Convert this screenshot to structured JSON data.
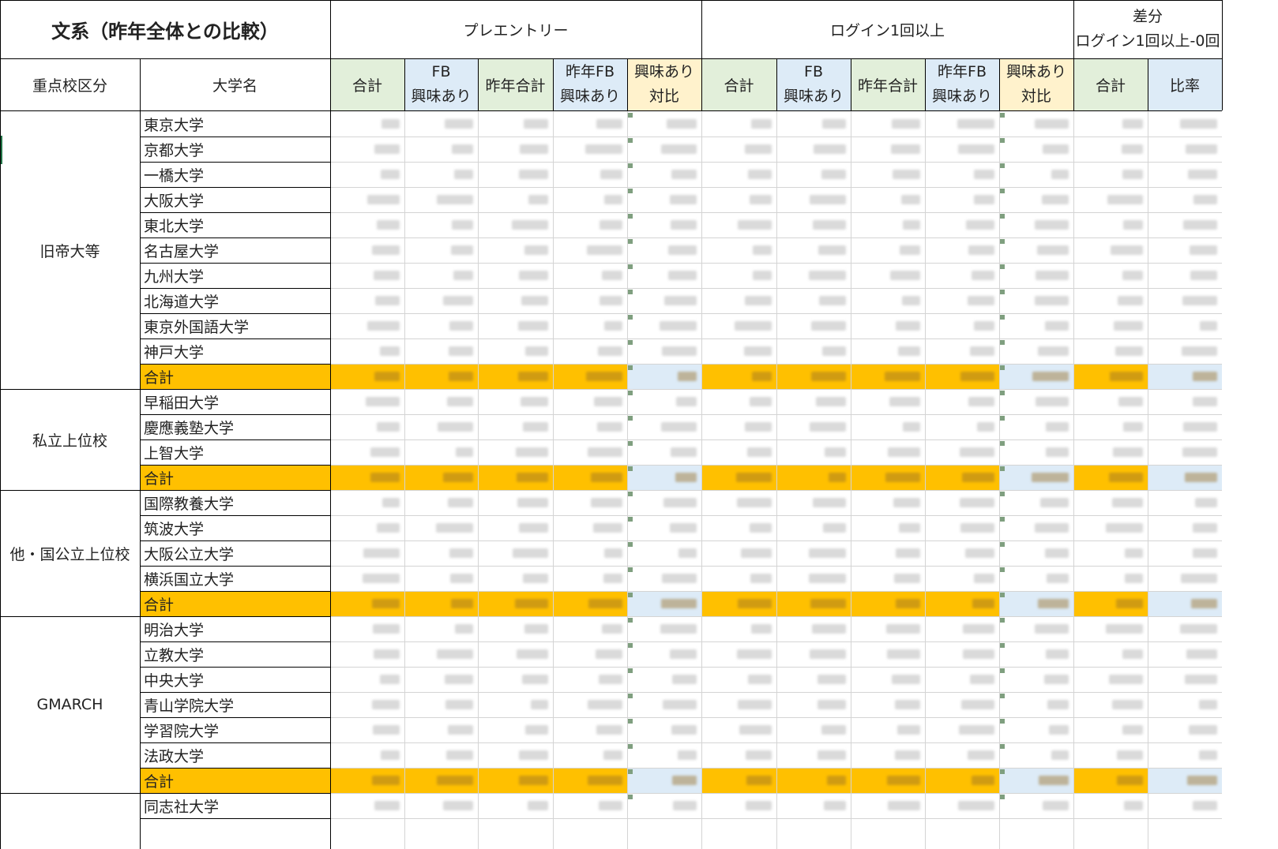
{
  "title": "文系（昨年全体との比較）",
  "header": {
    "groups": [
      "プレエントリー",
      "ログイン1回以上"
    ],
    "diff": {
      "line1": "差分",
      "line2": "ログイン1回以上-0回"
    },
    "col_category": "重点校区分",
    "col_university": "大学名",
    "sub_total": "合計",
    "sub_fb": [
      "FB",
      "興味あり"
    ],
    "sub_prev_total": "昨年合計",
    "sub_prev_fb": [
      "昨年FB",
      "興味あり"
    ],
    "sub_compare": [
      "興味あり",
      "対比"
    ],
    "sub_ratio": "比率"
  },
  "groups": [
    {
      "category": "旧帝大等",
      "universities": [
        "東京大学",
        "京都大学",
        "一橋大学",
        "大阪大学",
        "東北大学",
        "名古屋大学",
        "九州大学",
        "北海道大学",
        "東京外国語大学",
        "神戸大学"
      ],
      "total_label": "合計"
    },
    {
      "category": "私立上位校",
      "universities": [
        "早稲田大学",
        "慶應義塾大学",
        "上智大学"
      ],
      "total_label": "合計"
    },
    {
      "category": "他・国公立上位校",
      "universities": [
        "国際教養大学",
        "筑波大学",
        "大阪公立大学",
        "横浜国立大学"
      ],
      "total_label": "合計"
    },
    {
      "category": "GMARCH",
      "universities": [
        "明治大学",
        "立教大学",
        "中央大学",
        "青山学院大学",
        "学習院大学",
        "法政大学"
      ],
      "total_label": "合計"
    },
    {
      "category": "",
      "universities": [
        "同志社大学"
      ],
      "total_label": null
    }
  ],
  "colors": {
    "orange": "#ffc000",
    "green": "#e2efda",
    "blue": "#ddebf7",
    "yellow": "#fff2cc",
    "excel_green": "#217346"
  }
}
